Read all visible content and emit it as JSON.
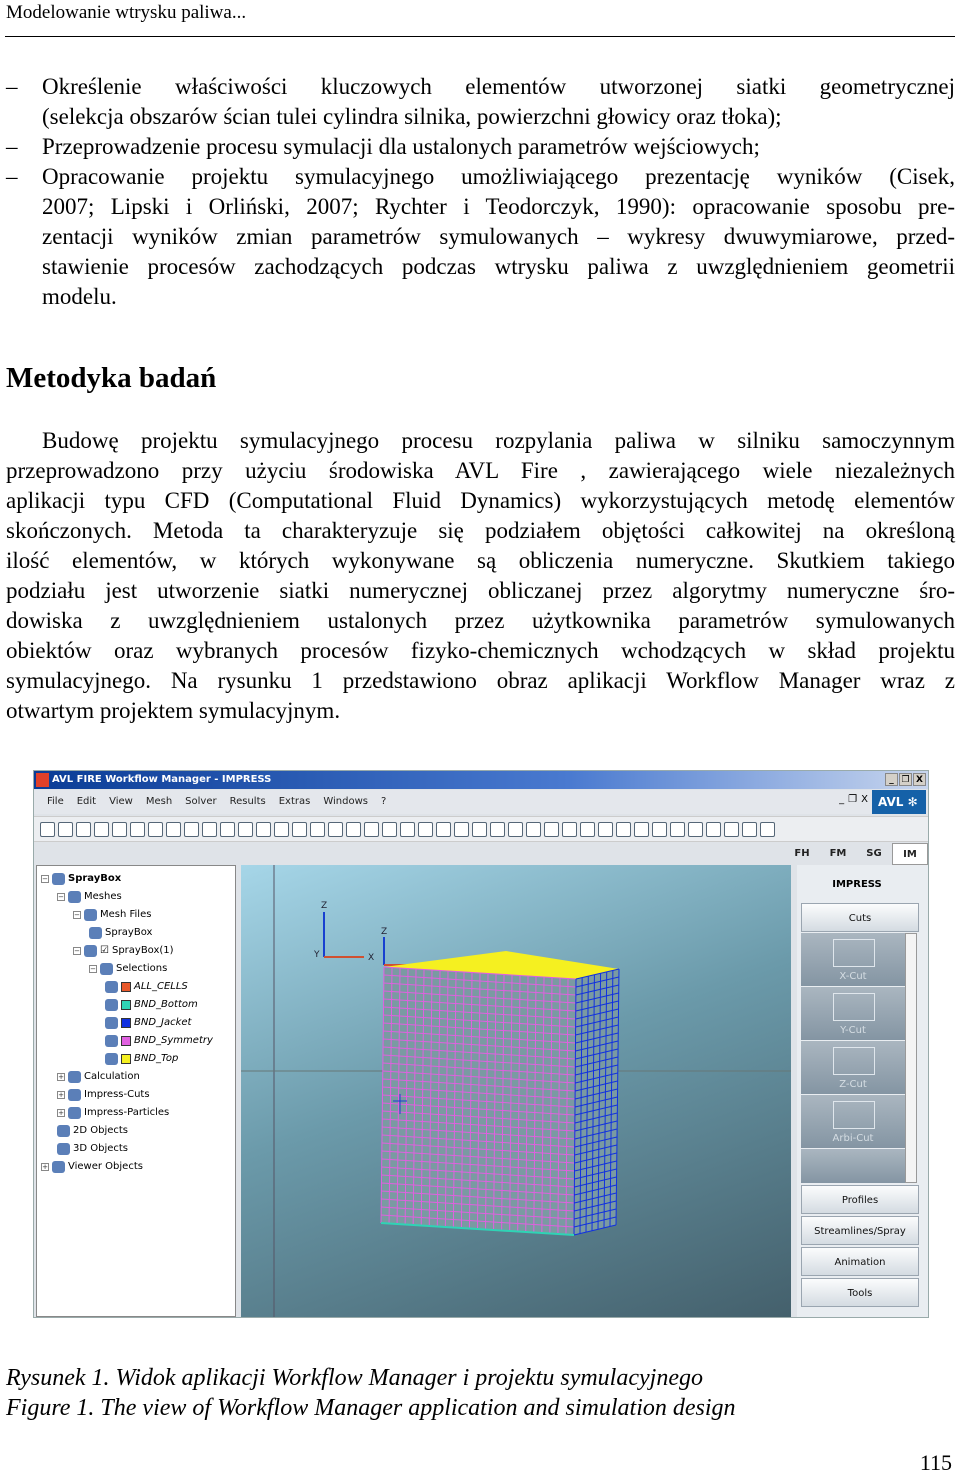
{
  "running_header": "Modelowanie wtrysku paliwa...",
  "bullets": [
    [
      "Określenie właściwości kluczowych elementów utworzonej siatki geometrycznej",
      "(selekcja obszarów ścian tulei cylindra silnika, powierzchni głowicy oraz tłoka);"
    ],
    [
      "Przeprowadzenie procesu symulacji dla ustalonych parametrów wejściowych;"
    ],
    [
      "Opracowanie projektu symulacyjnego umożliwiającego prezentację wyników (Cisek,",
      "2007; Lipski i Orliński, 2007; Rychter i Teodorczyk, 1990): opracowanie sposobu pre-",
      "zentacji wyników zmian parametrów symulowanych – wykresy dwuwymiarowe, przed-",
      "stawienie procesów zachodzących podczas wtrysku paliwa z uwzględnieniem geometrii",
      "modelu."
    ]
  ],
  "dash": "–",
  "section_heading": "Metodyka badań",
  "paragraph": [
    "Budowę projektu symulacyjnego procesu rozpylania paliwa w silniku samoczynnym",
    "przeprowadzono przy użyciu środowiska AVL Fire , zawierającego wiele niezależnych",
    "aplikacji typu CFD (Computational Fluid Dynamics) wykorzystujących metodę elementów",
    "skończonych. Metoda ta charakteryzuje się podziałem objętości całkowitej na określoną",
    "ilość elementów, w których wykonywane są obliczenia numeryczne. Skutkiem takiego",
    "podziału jest utworzenie siatki numerycznej obliczanej przez algorytmy numeryczne śro-",
    "dowiska z uwzględnieniem ustalonych przez użytkownika parametrów symulowanych",
    "obiektów oraz wybranych procesów fizyko-chemicznych wchodzących w skład projektu",
    "symulacyjnego. Na rysunku 1 przedstawiono obraz aplikacji Workflow Manager wraz z",
    "otwartym projektem symulacyjnym."
  ],
  "figure": {
    "window_title": "AVL FIRE Workflow Manager - IMPRESS",
    "window_buttons": [
      "_",
      "❐",
      "X"
    ],
    "menu": [
      "File",
      "Edit",
      "View",
      "Mesh",
      "Solver",
      "Results",
      "Extras",
      "Windows",
      "?"
    ],
    "brand": "AVL ✻",
    "toolbar_icons": [
      "new-icon",
      "open-icon",
      "save-icon",
      "print-icon",
      "import-icon",
      "export-icon",
      "load-icon",
      "reload-icon",
      "copy-icon",
      "cut-icon",
      "paste-icon",
      "delete-icon",
      "properties-icon",
      "undo-icon",
      "redo-icon",
      "box-icon",
      "box2-icon",
      "fill-icon",
      "shade-icon",
      "zoom-icon",
      "rotate-icon",
      "axis-icon",
      "view1-icon",
      "view2-icon",
      "view3-icon",
      "view4-icon",
      "view5-icon",
      "view6-icon",
      "view7-icon",
      "view8-icon",
      "view9-icon",
      "lines-icon",
      "solid-icon",
      "sphere-icon",
      "pick-icon",
      "x-icon",
      "edit1-icon",
      "edit2-icon",
      "edit3-icon",
      "edit4-icon",
      "edit5-icon"
    ],
    "tabs": [
      "FH",
      "FM",
      "SG",
      "IM"
    ],
    "active_tab": "IM",
    "tree": [
      {
        "label": "SprayBox",
        "level": 0,
        "toggle": "−",
        "bold": true
      },
      {
        "label": "Meshes",
        "level": 1,
        "toggle": "−"
      },
      {
        "label": "Mesh Files",
        "level": 2,
        "toggle": "−"
      },
      {
        "label": "SprayBox",
        "level": 3
      },
      {
        "label": "SprayBox(1)",
        "level": 2,
        "toggle": "−",
        "checkbox": "☑"
      },
      {
        "label": "Selections",
        "level": 3,
        "toggle": "−"
      },
      {
        "label": "ALL_CELLS",
        "level": 4,
        "color": "#e8582a",
        "italic": true
      },
      {
        "label": "BND_Bottom",
        "level": 4,
        "color": "#2fd3b5",
        "italic": true
      },
      {
        "label": "BND_Jacket",
        "level": 4,
        "color": "#1030e0",
        "italic": true
      },
      {
        "label": "BND_Symmetry",
        "level": 4,
        "color": "#e060e0",
        "italic": true
      },
      {
        "label": "BND_Top",
        "level": 4,
        "color": "#f5f020",
        "italic": true
      },
      {
        "label": "Calculation",
        "level": 1,
        "toggle": "+"
      },
      {
        "label": "Impress-Cuts",
        "level": 1,
        "toggle": "+"
      },
      {
        "label": "Impress-Particles",
        "level": 1,
        "toggle": "+"
      },
      {
        "label": "2D Objects",
        "level": 1
      },
      {
        "label": "3D Objects",
        "level": 1
      },
      {
        "label": "Viewer Objects",
        "level": 0,
        "toggle": "+"
      }
    ],
    "axes": {
      "z": "Z",
      "x": "X",
      "y": "Y"
    },
    "mesh_colors": {
      "top": "#f5f020",
      "symmetry": "#e060e0",
      "jacket": "#1030e0",
      "bottom": "#2fd3b5"
    },
    "panel_title": "IMPRESS",
    "cuts_button": "Cuts",
    "cut_items": [
      "X-Cut",
      "Y-Cut",
      "Z-Cut",
      "Arbi-Cut"
    ],
    "panel_buttons": [
      "Profiles",
      "Streamlines/Spray",
      "Animation",
      "Tools"
    ]
  },
  "caption_pl": "Rysunek 1. Widok aplikacji Workflow Manager i projektu symulacyjnego",
  "caption_en": "Figure 1. The view of Workflow Manager application and simulation design",
  "page_number": "115"
}
